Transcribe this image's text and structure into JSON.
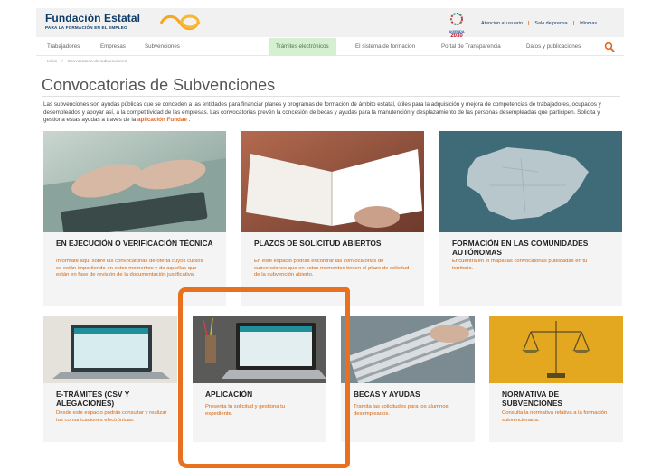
{
  "header": {
    "logo_title": "Fundación Estatal",
    "logo_subtitle": "PARA LA FORMACIÓN EN EL EMPLEO",
    "agenda_text": "AGENDA",
    "agenda_year": "2030",
    "top_links": [
      "Atención al usuario",
      "Sala de prensa",
      "Idiomas"
    ]
  },
  "nav": {
    "items": [
      "Trabajadores",
      "Empresas",
      "Subvenciones",
      "Trámites electrónicos",
      "El sistema de formación",
      "Portal de Transparencia",
      "Datos y publicaciones"
    ],
    "active": "Trámites electrónicos"
  },
  "breadcrumb": [
    "Inicio",
    "Convocatoria de subvenciones"
  ],
  "page_title": "Convocatorias de Subvenciones",
  "intro": {
    "text": "Las subvenciones son ayudas públicas que se conceden a las entidades para financiar planes y programas de formación de ámbito estatal, útiles para la adquisición y mejora de competencias de trabajadores, ocupados y desempleados y apoyar así, a la competitividad de las empresas. Las convocatorias prevén la concesión de becas y ayudas para la manutención y desplazamiento de las personas desempleadas que participen. Solicita y gestiona estas ayudas a través de la ",
    "link": "aplicación Fundae",
    "suffix": " ."
  },
  "cards": [
    {
      "title": "EN EJECUCIÓN O VERIFICACIÓN TÉCNICA",
      "text": "Infórmate aquí sobre las convocatorias de oferta cuyos cursos se están impartiendo en estos momentos y de aquellas que están en fase de revisión de la documentación justificativa."
    },
    {
      "title": "PLAZOS DE SOLICITUD ABIERTOS",
      "text": "En este espacio podrás encontrar las convocatorias de subvenciones que en estos momentos tienen el plazo de solicitud de la subvención abierto."
    },
    {
      "title": "FORMACIÓN EN LAS COMUNIDADES AUTÓNOMAS",
      "text": "Encuentra en el mapa las convocatorias publicadas en tu territorio."
    },
    {
      "title": "E-TRÁMITES (CSV Y ALEGACIONES)",
      "text": "Desde este espacio podrás consultar y realizar tus comunicaciones electrónicas."
    },
    {
      "title": "APLICACIÓN",
      "text": "Presenta tu solicitud y gestiona tu expediente."
    },
    {
      "title": "BECAS Y AYUDAS",
      "text": "Tramita las solicitudes para los alumnos desempleados."
    },
    {
      "title": "NORMATIVA DE SUBVENCIONES",
      "text": "Consulta la normativa relativa a la formación subvencionada."
    }
  ],
  "colors": {
    "accent": "#e5671e",
    "brand": "#0d3b66",
    "nav_active_bg": "#d6eed2",
    "card_bg": "#f4f4f4",
    "highlight": "#e8701f"
  }
}
